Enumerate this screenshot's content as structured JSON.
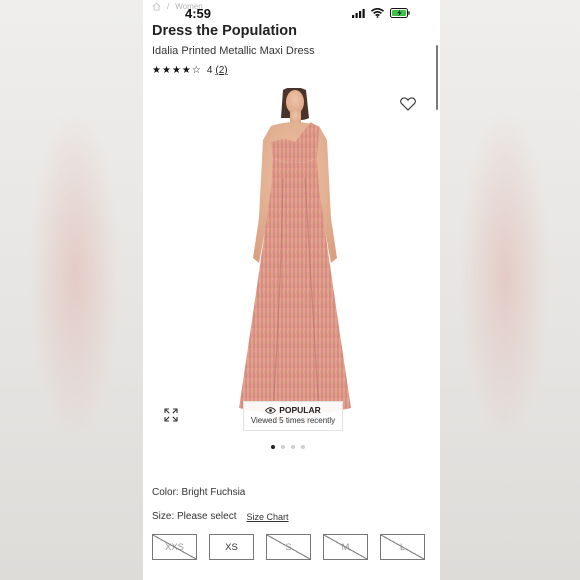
{
  "breadcrumb": {
    "current": "Women"
  },
  "status_bar": {
    "time": "4:59"
  },
  "product": {
    "brand": "Dress the Population",
    "name": "Idalia Printed Metallic Maxi Dress",
    "rating": {
      "value": 4,
      "max": 5,
      "count_label": "4",
      "reviews_link": "(2)"
    },
    "image_alt": "Woman wearing multicolor printed one-shoulder maxi dress"
  },
  "badge": {
    "title": "POPULAR",
    "subtitle": "Viewed 5 times recently"
  },
  "carousel": {
    "count": 4,
    "active_index": 0
  },
  "color": {
    "label": "Color: Bright Fuchsia"
  },
  "size": {
    "label": "Size: Please select",
    "chart_link": "Size Chart",
    "options": [
      {
        "label": "XXS",
        "available": false
      },
      {
        "label": "XS",
        "available": true
      },
      {
        "label": "S",
        "available": false
      },
      {
        "label": "M",
        "available": false
      },
      {
        "label": "L",
        "available": false
      }
    ]
  },
  "icons": {
    "home": "home-icon",
    "signal": "signal-icon",
    "wifi": "wifi-icon",
    "battery": "battery-icon",
    "favorite": "heart-icon",
    "expand": "expand-icon",
    "views": "eye-icon"
  }
}
